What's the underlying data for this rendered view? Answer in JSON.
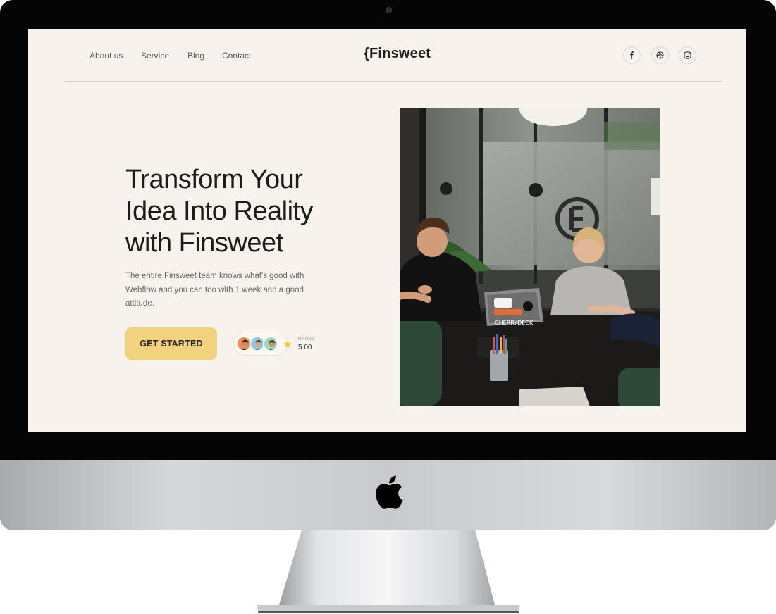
{
  "nav": {
    "links": [
      "About us",
      "Service",
      "Blog",
      "Contact"
    ],
    "logo": "{Finsweet",
    "social": [
      "facebook-icon",
      "dribbble-icon",
      "instagram-icon"
    ]
  },
  "hero": {
    "headline": [
      "Transform Your",
      "Idea Into Reality",
      "with Finsweet"
    ],
    "subtext": "The entire Finsweet team knows what's good with Webflow and you can too with 1 week and a good attitude.",
    "cta_label": "GET STARTED",
    "rating_label": "RATING",
    "rating_value": "5.00"
  },
  "colors": {
    "page_background": "#f7f3ec",
    "accent": "#f3d27f",
    "text": "#1c1c1c",
    "star": "#f5c518"
  }
}
